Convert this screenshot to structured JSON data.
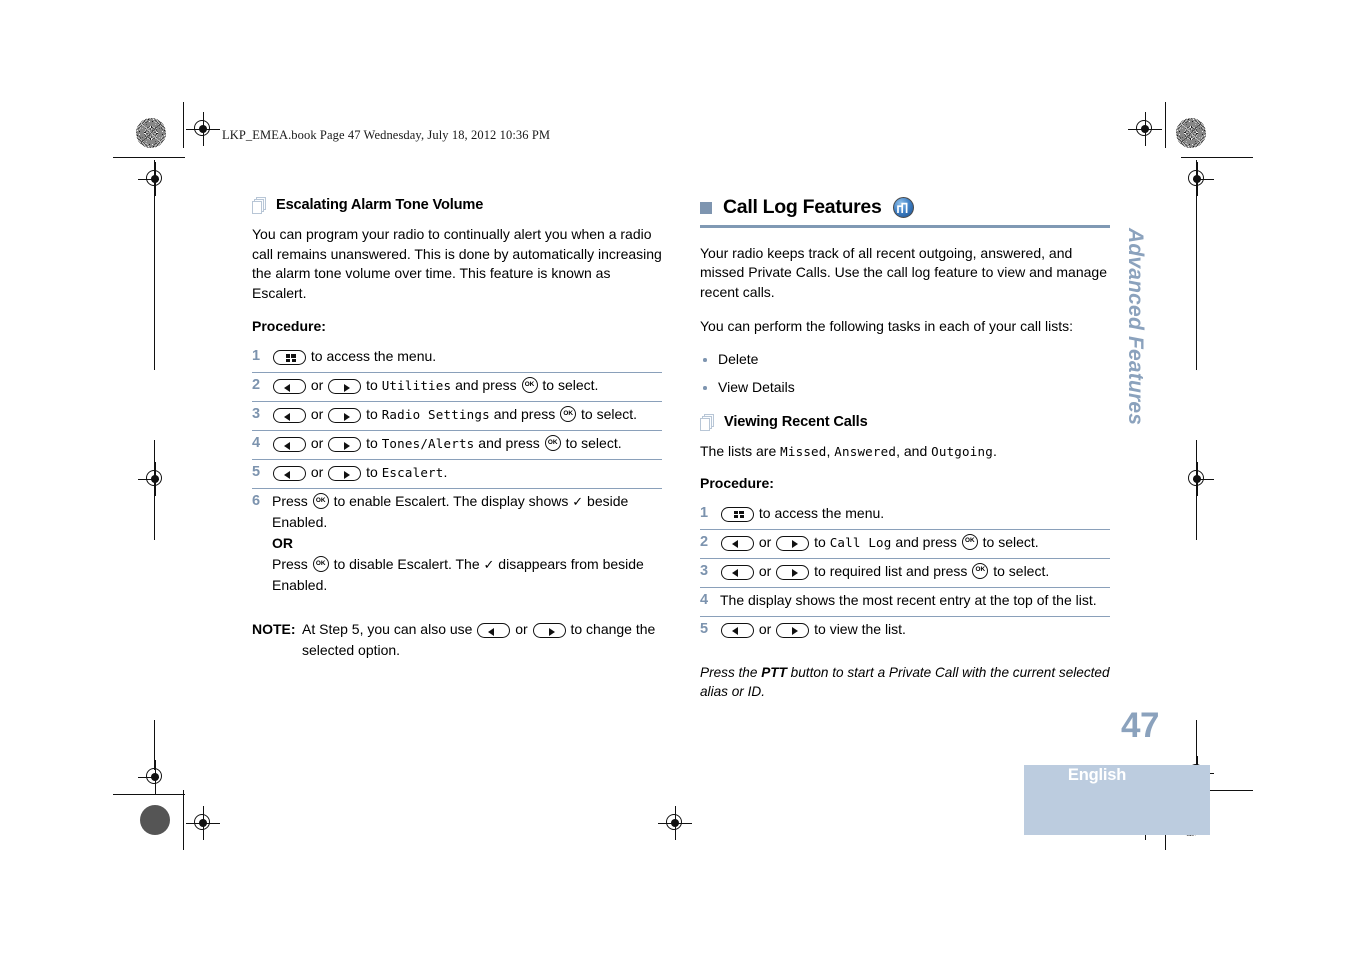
{
  "page": {
    "file_banner": "LKP_EMEA.book  Page 47  Wednesday, July 18, 2012  10:36 PM",
    "page_number": "47",
    "language_band": "English",
    "side_tab": "Advanced Features",
    "accent_color": "#8099b4",
    "rule_color": "#8aa0ba",
    "number_color": "#7c93ae",
    "band_color": "#bcccdf"
  },
  "left_column": {
    "heading": {
      "icon": "document-stack-icon",
      "text": "Escalating Alarm Tone Volume"
    },
    "intro": "You can program your radio to continually alert you when a radio call remains unanswered. This is done by automatically increasing the alarm tone volume over time. This feature is known as Escalert.",
    "procedure_label": "Procedure:",
    "steps": [
      {
        "num": "1",
        "parts": [
          {
            "type": "key",
            "key": "menu"
          },
          {
            "type": "text",
            "text": " to access the menu."
          }
        ]
      },
      {
        "num": "2",
        "parts": [
          {
            "type": "key",
            "key": "left"
          },
          {
            "type": "text",
            "text": " or "
          },
          {
            "type": "key",
            "key": "right"
          },
          {
            "type": "text",
            "text": " to "
          },
          {
            "type": "lcd",
            "text": "Utilities"
          },
          {
            "type": "text",
            "text": " and press "
          },
          {
            "type": "key",
            "key": "ok"
          },
          {
            "type": "text",
            "text": " to select."
          }
        ]
      },
      {
        "num": "3",
        "parts": [
          {
            "type": "key",
            "key": "left"
          },
          {
            "type": "text",
            "text": " or "
          },
          {
            "type": "key",
            "key": "right"
          },
          {
            "type": "text",
            "text": " to "
          },
          {
            "type": "lcd",
            "text": "Radio Settings"
          },
          {
            "type": "text",
            "text": " and press "
          },
          {
            "type": "key",
            "key": "ok"
          },
          {
            "type": "text",
            "text": " to select."
          }
        ]
      },
      {
        "num": "4",
        "parts": [
          {
            "type": "key",
            "key": "left"
          },
          {
            "type": "text",
            "text": " or "
          },
          {
            "type": "key",
            "key": "right"
          },
          {
            "type": "text",
            "text": " to "
          },
          {
            "type": "lcd",
            "text": "Tones/Alerts"
          },
          {
            "type": "text",
            "text": " and press "
          },
          {
            "type": "key",
            "key": "ok"
          },
          {
            "type": "text",
            "text": " to select."
          }
        ]
      },
      {
        "num": "5",
        "parts": [
          {
            "type": "key",
            "key": "left"
          },
          {
            "type": "text",
            "text": " or "
          },
          {
            "type": "key",
            "key": "right"
          },
          {
            "type": "text",
            "text": " to "
          },
          {
            "type": "lcd",
            "text": "Escalert"
          },
          {
            "type": "text",
            "text": "."
          }
        ]
      },
      {
        "num": "6",
        "parts": [
          {
            "type": "text",
            "text": "Press "
          },
          {
            "type": "key",
            "key": "ok"
          },
          {
            "type": "text",
            "text": " to enable Escalert. The display shows "
          },
          {
            "type": "check",
            "text": "✓"
          },
          {
            "type": "text",
            "text": " beside Enabled."
          },
          {
            "type": "break"
          },
          {
            "type": "bold",
            "text": "OR"
          },
          {
            "type": "break"
          },
          {
            "type": "text",
            "text": "Press "
          },
          {
            "type": "key",
            "key": "ok"
          },
          {
            "type": "text",
            "text": " to disable Escalert. The "
          },
          {
            "type": "check",
            "text": "✓"
          },
          {
            "type": "text",
            "text": " disappears from beside Enabled."
          }
        ]
      }
    ],
    "note": {
      "label": "NOTE:",
      "parts": [
        {
          "type": "text",
          "text": "At Step 5, you can also use "
        },
        {
          "type": "key",
          "key": "left"
        },
        {
          "type": "text",
          "text": " or "
        },
        {
          "type": "key",
          "key": "right"
        },
        {
          "type": "text",
          "text": " to change the selected option."
        }
      ]
    }
  },
  "right_column": {
    "heading": {
      "text": "Call Log Features",
      "badge_icon": "digital-square-wave-icon"
    },
    "intro1": "Your radio keeps track of all recent outgoing, answered, and missed Private Calls. Use the call log feature to view and manage recent calls.",
    "intro2": "You can perform the following tasks in each of your call lists:",
    "bullets": [
      "Delete",
      "View Details"
    ],
    "subheading": {
      "icon": "document-stack-icon",
      "text": "Viewing Recent Calls"
    },
    "lists_sentence": {
      "parts": [
        {
          "type": "text",
          "text": "The lists are "
        },
        {
          "type": "lcd",
          "text": "Missed"
        },
        {
          "type": "text",
          "text": ", "
        },
        {
          "type": "lcd",
          "text": "Answered"
        },
        {
          "type": "text",
          "text": ", and "
        },
        {
          "type": "lcd",
          "text": "Outgoing"
        },
        {
          "type": "text",
          "text": "."
        }
      ]
    },
    "procedure_label": "Procedure:",
    "steps": [
      {
        "num": "1",
        "parts": [
          {
            "type": "key",
            "key": "menu"
          },
          {
            "type": "text",
            "text": " to access the menu."
          }
        ]
      },
      {
        "num": "2",
        "parts": [
          {
            "type": "key",
            "key": "left"
          },
          {
            "type": "text",
            "text": " or "
          },
          {
            "type": "key",
            "key": "right"
          },
          {
            "type": "text",
            "text": " to "
          },
          {
            "type": "lcd",
            "text": "Call Log"
          },
          {
            "type": "text",
            "text": " and press "
          },
          {
            "type": "key",
            "key": "ok"
          },
          {
            "type": "text",
            "text": " to select."
          }
        ]
      },
      {
        "num": "3",
        "parts": [
          {
            "type": "key",
            "key": "left"
          },
          {
            "type": "text",
            "text": " or "
          },
          {
            "type": "key",
            "key": "right"
          },
          {
            "type": "text",
            "text": " to required list and press "
          },
          {
            "type": "key",
            "key": "ok"
          },
          {
            "type": "text",
            "text": " to select."
          }
        ]
      },
      {
        "num": "4",
        "parts": [
          {
            "type": "text",
            "text": "The display shows the most recent entry at the top of the list."
          }
        ]
      },
      {
        "num": "5",
        "parts": [
          {
            "type": "key",
            "key": "left"
          },
          {
            "type": "text",
            "text": " or "
          },
          {
            "type": "key",
            "key": "right"
          },
          {
            "type": "text",
            "text": " to view the list."
          }
        ]
      }
    ],
    "footer_note": {
      "parts": [
        {
          "type": "text",
          "text": "Press the "
        },
        {
          "type": "bold",
          "text": "PTT"
        },
        {
          "type": "text",
          "text": " button to start a Private Call with the current selected alias or ID."
        }
      ]
    }
  }
}
